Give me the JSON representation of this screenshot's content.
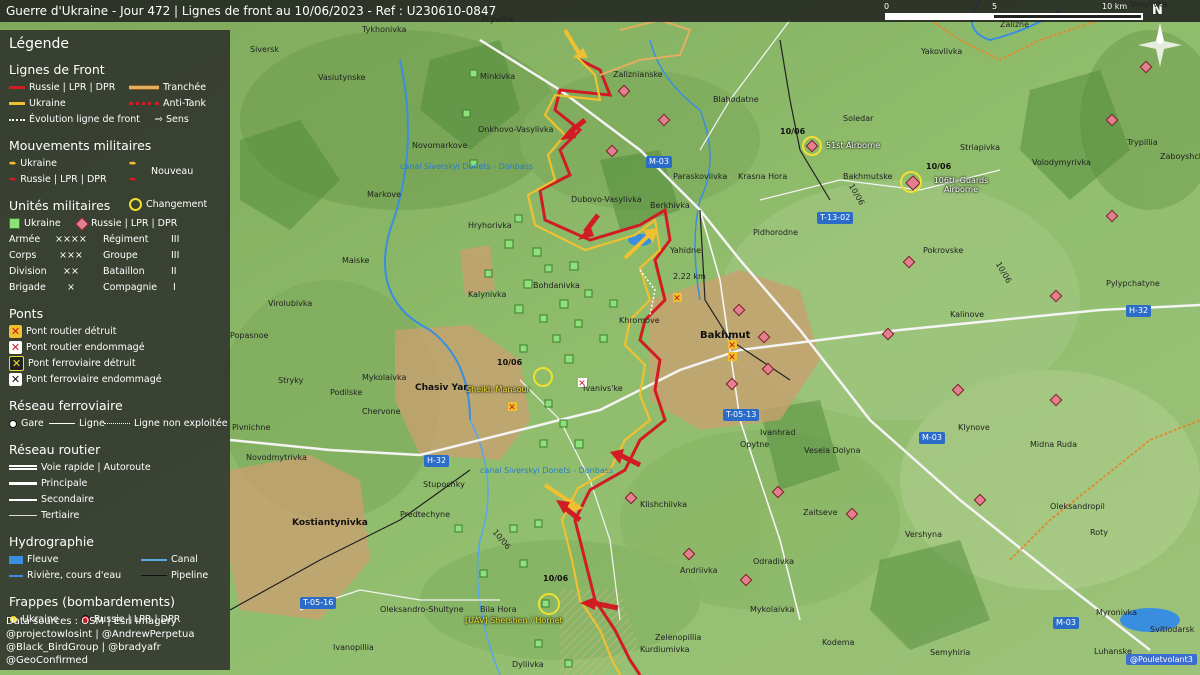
{
  "title": "Guerre d'Ukraine - Jour 472 | Lignes de front au 10/06/2023 - Ref : U230610-0847",
  "scale": {
    "label_0": "0",
    "label_5": "5",
    "label_10": "10 km",
    "north": "N"
  },
  "legend": {
    "heading": "Légende",
    "front": {
      "title": "Lignes de Front",
      "russia": "Russie | LPR | DPR",
      "ukraine": "Ukraine",
      "evolution": "Évolution ligne de front",
      "trench": "Tranchée",
      "antitank": "Anti-Tank",
      "direction": "Sens"
    },
    "movements": {
      "title": "Mouvements militaires",
      "ukraine": "Ukraine",
      "russia": "Russie | LPR | DPR",
      "new": "Nouveau"
    },
    "units": {
      "title": "Unités militaires",
      "change": "Changement",
      "ukraine": "Ukraine",
      "russia": "Russie | LPR | DPR",
      "rows": [
        {
          "a": "Armée",
          "as": "××××",
          "b": "Régiment",
          "bs": "III"
        },
        {
          "a": "Corps",
          "as": "×××",
          "b": "Groupe",
          "bs": "III"
        },
        {
          "a": "Division",
          "as": "××",
          "b": "Bataillon",
          "bs": "II"
        },
        {
          "a": "Brigade",
          "as": "×",
          "b": "Compagnie",
          "bs": "I"
        }
      ]
    },
    "bridges": {
      "title": "Ponts",
      "items": [
        "Pont routier détruit",
        "Pont routier endommagé",
        "Pont ferroviaire détruit",
        "Pont ferroviaire endommagé"
      ]
    },
    "rail": {
      "title": "Réseau ferroviaire",
      "station": "Gare",
      "line": "Ligne",
      "unused": "Ligne non exploitée"
    },
    "roads": {
      "title": "Réseau routier",
      "items": [
        "Voie rapide | Autoroute",
        "Principale",
        "Secondaire",
        "Tertiaire"
      ]
    },
    "hydro": {
      "title": "Hydrographie",
      "river_big": "Fleuve",
      "canal": "Canal",
      "river": "Rivière, cours d'eau",
      "pipeline": "Pipeline"
    },
    "strikes": {
      "title": "Frappes (bombardements)",
      "ukraine": "Ukraine",
      "russia": "Russie | LPR | DPR"
    },
    "sources": [
      "Data sources : OSM | Esri Imagery",
      "@projectowlosint | @AndrewPerpetua",
      "@Black_BirdGroup | @bradyafr",
      "@GeoConfirmed"
    ]
  },
  "places": {
    "tykhonivka": "Tykhonivka",
    "siversk": "Siversk",
    "vasiutynske": "Vasiutynske",
    "minkivka": "Minkivka",
    "pryvillia": "Pryvillia",
    "zaliznianske": "Zaliznianske",
    "yakovlivka": "Yakovlivka",
    "vasylivka": "Vasylivka",
    "onkhovo": "Onkhovo-Vasylivka",
    "blahodatne": "Blahodatne",
    "soledar": "Soledar",
    "trypillia": "Trypillia",
    "zaboyshchi": "Zaboyshchi",
    "novomarkove": "Novomarkove",
    "paraskoviivka": "Paraskoviivka",
    "krasnahora": "Krasna Hora",
    "striapivka": "Striapivka",
    "volodymyrivka": "Volodymyrivka",
    "bakhmutske": "Bakhmutske",
    "markove": "Markove",
    "dubovo": "Dubovo-Vasylivka",
    "berkhivka": "Berkhivka",
    "hryhorivka": "Hryhorivka",
    "yahidne": "Yahidne",
    "pidhorodne": "Pidhorodne",
    "pokrovske": "Pokrovske",
    "maiske": "Maiske",
    "bohdanivka": "Bohdanivka",
    "pylypchatyne": "Pylypchatyne",
    "virolubivka": "Virolubivka",
    "kalynivka": "Kalynivka",
    "khromove": "Khromove",
    "bakhmut": "Bakhmut",
    "kalinove": "Kalinove",
    "popasnoe": "Popasnoe",
    "mykolaivka": "Mykolaivka",
    "chasivyar": "Chasiv Yar",
    "ivanivske": "Ivanivs'ke",
    "stryky": "Stryky",
    "podilske": "Podilske",
    "chervone": "Chervone",
    "ivanhrad": "Ivanhrad",
    "opytne": "Opytne",
    "klynove": "Klynove",
    "pivnichne": "Pivnichne",
    "veseladolyna": "Vesela Dolyna",
    "midnaruda": "Midna Ruda",
    "novodmytrivka": "Novodmytrivka",
    "stupochky": "Stupochky",
    "klishchiivka": "Klishchiivka",
    "zaitseve": "Zaitseve",
    "oleksandropil": "Oleksandropil",
    "kostiantynivka": "Kostiantynivka",
    "predtechyne": "Predtechyne",
    "vershyna": "Vershyna",
    "odradivka": "Odradivka",
    "andriivka": "Andriivka",
    "roty": "Roty",
    "bilahora": "Bila Hora",
    "oleksandroshultyne": "Oleksandro-Shultyne",
    "mykolaivka2": "Mykolaivka",
    "zelenopillia": "Zelenopillia",
    "kurdiumivka": "Kurdiumivka",
    "ivanopillia": "Ivanopillia",
    "dyliivka": "Dyliivka",
    "kodema": "Kodema",
    "semyhiria": "Semyhiria",
    "luhanske": "Luhanske",
    "myronivka": "Myronivka",
    "zalizne": "Zalizne",
    "svitlodarsk": "Svitlodarsk"
  },
  "water": {
    "canal1": "canal Siverskyi Donets - Donbass",
    "canal2": "canal Siverskyi Donets - Donbass"
  },
  "annotations": {
    "airborne51": "51st Airborne",
    "guards106": "106th Guards Airborne",
    "sheikh": "Sheikh Mansour",
    "uav": "[UAV] Shershen / Hornet",
    "distance": "2.22 km",
    "date1": "10/06",
    "date2": "10/06",
    "date3": "10/06",
    "date4": "10/06"
  },
  "roads": {
    "m03a": "M-03",
    "m03b": "M-03",
    "m03c": "M-03",
    "h32a": "H-32",
    "h32b": "H-32",
    "t1302": "T-13-02",
    "t0513": "T-05-13",
    "t0516": "T-05-16",
    "r1006a": "10/06",
    "r1006b": "10/06",
    "r1006c": "10/06"
  },
  "credit": "@Pouletvolant3",
  "colors": {
    "russia": "#d01c22",
    "ukraine": "#f0c030",
    "unit_ua": "#8ee07a",
    "unit_ru": "#e37f8f"
  }
}
